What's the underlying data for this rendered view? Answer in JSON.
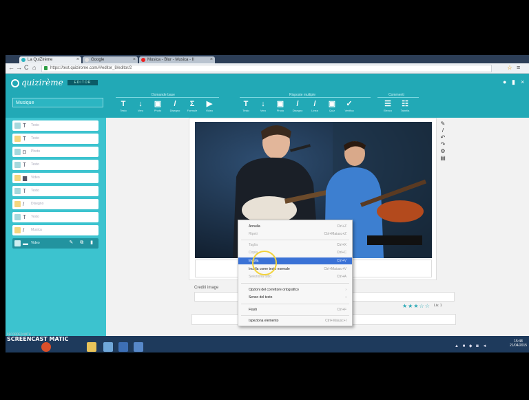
{
  "browser": {
    "tabs": [
      {
        "label": "La QuiZirème",
        "active": true
      },
      {
        "label": "Google",
        "active": false
      },
      {
        "label": "Musica - Blur - Musica - Il",
        "active": false
      }
    ],
    "url": "https://test.quizirome.com/#/editor_8/editor/2",
    "nav": {
      "back": "←",
      "forward": "→",
      "reload": "C",
      "home": "⌂"
    }
  },
  "app": {
    "logo": "quizirème",
    "project_badge": "EDITOR",
    "header_icons": [
      "help-icon",
      "print-icon",
      "close-icon"
    ]
  },
  "toolbar": {
    "quiz_title_value": "Musique",
    "groups": [
      {
        "label": "Domande base"
      },
      {
        "label": "Risposte multiple"
      },
      {
        "label": "Commenti"
      }
    ],
    "tools": [
      {
        "glyph": "T",
        "label": "Testo"
      },
      {
        "glyph": "↓",
        "label": "Vero"
      },
      {
        "glyph": "▣",
        "label": "Photo"
      },
      {
        "glyph": "/",
        "label": "Disegno"
      },
      {
        "glyph": "Σ",
        "label": "Formule"
      },
      {
        "glyph": "▶",
        "label": "Video"
      },
      {
        "glyph": "T",
        "label": "Testo"
      },
      {
        "glyph": "↓",
        "label": "Vero"
      },
      {
        "glyph": "▣",
        "label": "Photo"
      },
      {
        "glyph": "/",
        "label": "Disegno"
      },
      {
        "glyph": "/",
        "label": "Linea"
      },
      {
        "glyph": "▣",
        "label": "Quiz"
      },
      {
        "glyph": "✓",
        "label": "Verifica"
      },
      {
        "glyph": "☰",
        "label": "Elenco"
      },
      {
        "glyph": "☷",
        "label": "Tabella"
      }
    ]
  },
  "sidebar": {
    "items": [
      {
        "type": "T",
        "label": "Testo",
        "icon": "yellow-no"
      },
      {
        "type": "T",
        "label": "Testo",
        "icon": "yellow"
      },
      {
        "type": "◘",
        "label": "Photo",
        "icon": "yellow-no"
      },
      {
        "type": "T",
        "label": "Testo",
        "icon": "yellow-no"
      },
      {
        "type": "▆",
        "label": "Video",
        "icon": "yellow"
      },
      {
        "type": "T",
        "label": "Testo",
        "icon": "yellow-no"
      },
      {
        "type": "/",
        "label": "Disegno",
        "icon": "yellow"
      },
      {
        "type": "T",
        "label": "Testo",
        "icon": "yellow-no"
      },
      {
        "type": "/",
        "label": "Musica",
        "icon": "yellow"
      },
      {
        "type": "▬",
        "label": "Video",
        "icon": "active"
      }
    ],
    "active_actions": "✎ ⧉ ▮"
  },
  "main": {
    "edit_tools": [
      "✎",
      "/",
      "↶",
      "↷",
      "⚙",
      "▤"
    ],
    "crediti_label": "Crediti image",
    "stars": "★★★☆☆",
    "stars_label": "Liv. 1"
  },
  "context_menu": {
    "items": [
      {
        "label": "Annulla",
        "shortcut": "Ctrl+Z",
        "state": "normal"
      },
      {
        "label": "Ripeti",
        "shortcut": "Ctrl+Maiusc+Z",
        "state": "disabled"
      },
      {
        "sep": true
      },
      {
        "label": "Taglia",
        "shortcut": "Ctrl+X",
        "state": "disabled"
      },
      {
        "label": "Copia",
        "shortcut": "Ctrl+C",
        "state": "disabled"
      },
      {
        "label": "Incolla",
        "shortcut": "Ctrl+V",
        "state": "highlight"
      },
      {
        "label": "Incolla come testo normale",
        "shortcut": "Ctrl+Maiusc+V",
        "state": "normal"
      },
      {
        "label": "Seleziona tutto",
        "shortcut": "Ctrl+A",
        "state": "disabled"
      },
      {
        "sep": true
      },
      {
        "label": "Opzioni del correttore ortografico",
        "shortcut": "›",
        "state": "normal"
      },
      {
        "label": "Senso del testo",
        "shortcut": "›",
        "state": "normal"
      },
      {
        "sep": true
      },
      {
        "label": "Flash",
        "shortcut": "Ctrl+F",
        "state": "normal"
      },
      {
        "sep": true
      },
      {
        "label": "Ispeziona elemento",
        "shortcut": "Ctrl+Maiusc+I",
        "state": "normal"
      }
    ]
  },
  "taskbar": {
    "brand": "SCREENCAST",
    "brand_sub": "RECORDED WITH",
    "magic": "MATIC",
    "clock_time": "15:48",
    "clock_date": "21/04/2015"
  },
  "colors": {
    "accent": "#22a9b6",
    "sidebar": "#3cc3cf",
    "highlight": "#3a72d6"
  }
}
